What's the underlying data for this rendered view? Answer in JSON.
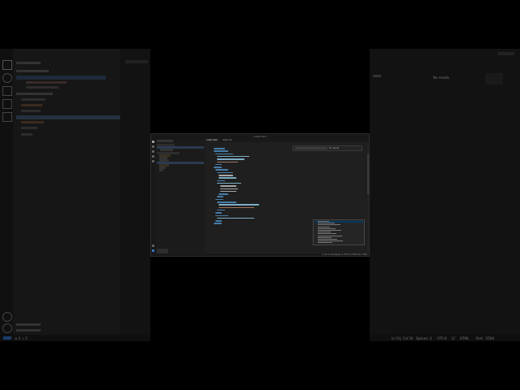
{
  "background_window": {
    "sidebar_rows": [
      {
        "label": "",
        "top": 0
      },
      {
        "label": "",
        "top": 0
      }
    ],
    "right_panel": {
      "search_label": "",
      "no_results": "No results"
    },
    "status_items": [
      "Ln 54, Col 56",
      "Spaces: 4",
      "UTF-8",
      "LF",
      "HTML",
      "Port : 5500"
    ]
  },
  "window": {
    "title": "index.html",
    "tabs": [
      {
        "label": "index.html",
        "active": true
      },
      {
        "label": "style.css",
        "active": false
      }
    ],
    "breadcrumb": "",
    "find": {
      "results": "No results"
    },
    "suggestions": [
      "",
      "",
      "",
      "",
      "",
      "",
      "",
      "",
      "",
      "",
      "",
      "",
      ""
    ],
    "status_left": "",
    "status_right": "Ln 54, Col 56  Spaces: 4  UTF-8  LF  HTML  Port : 5500"
  },
  "colors": {
    "tag": "#569cd6",
    "attr": "#9cdcfe",
    "string": "#ce9178",
    "text": "#d4d4d4",
    "selection": "#04395e",
    "accent": "#007acc"
  }
}
